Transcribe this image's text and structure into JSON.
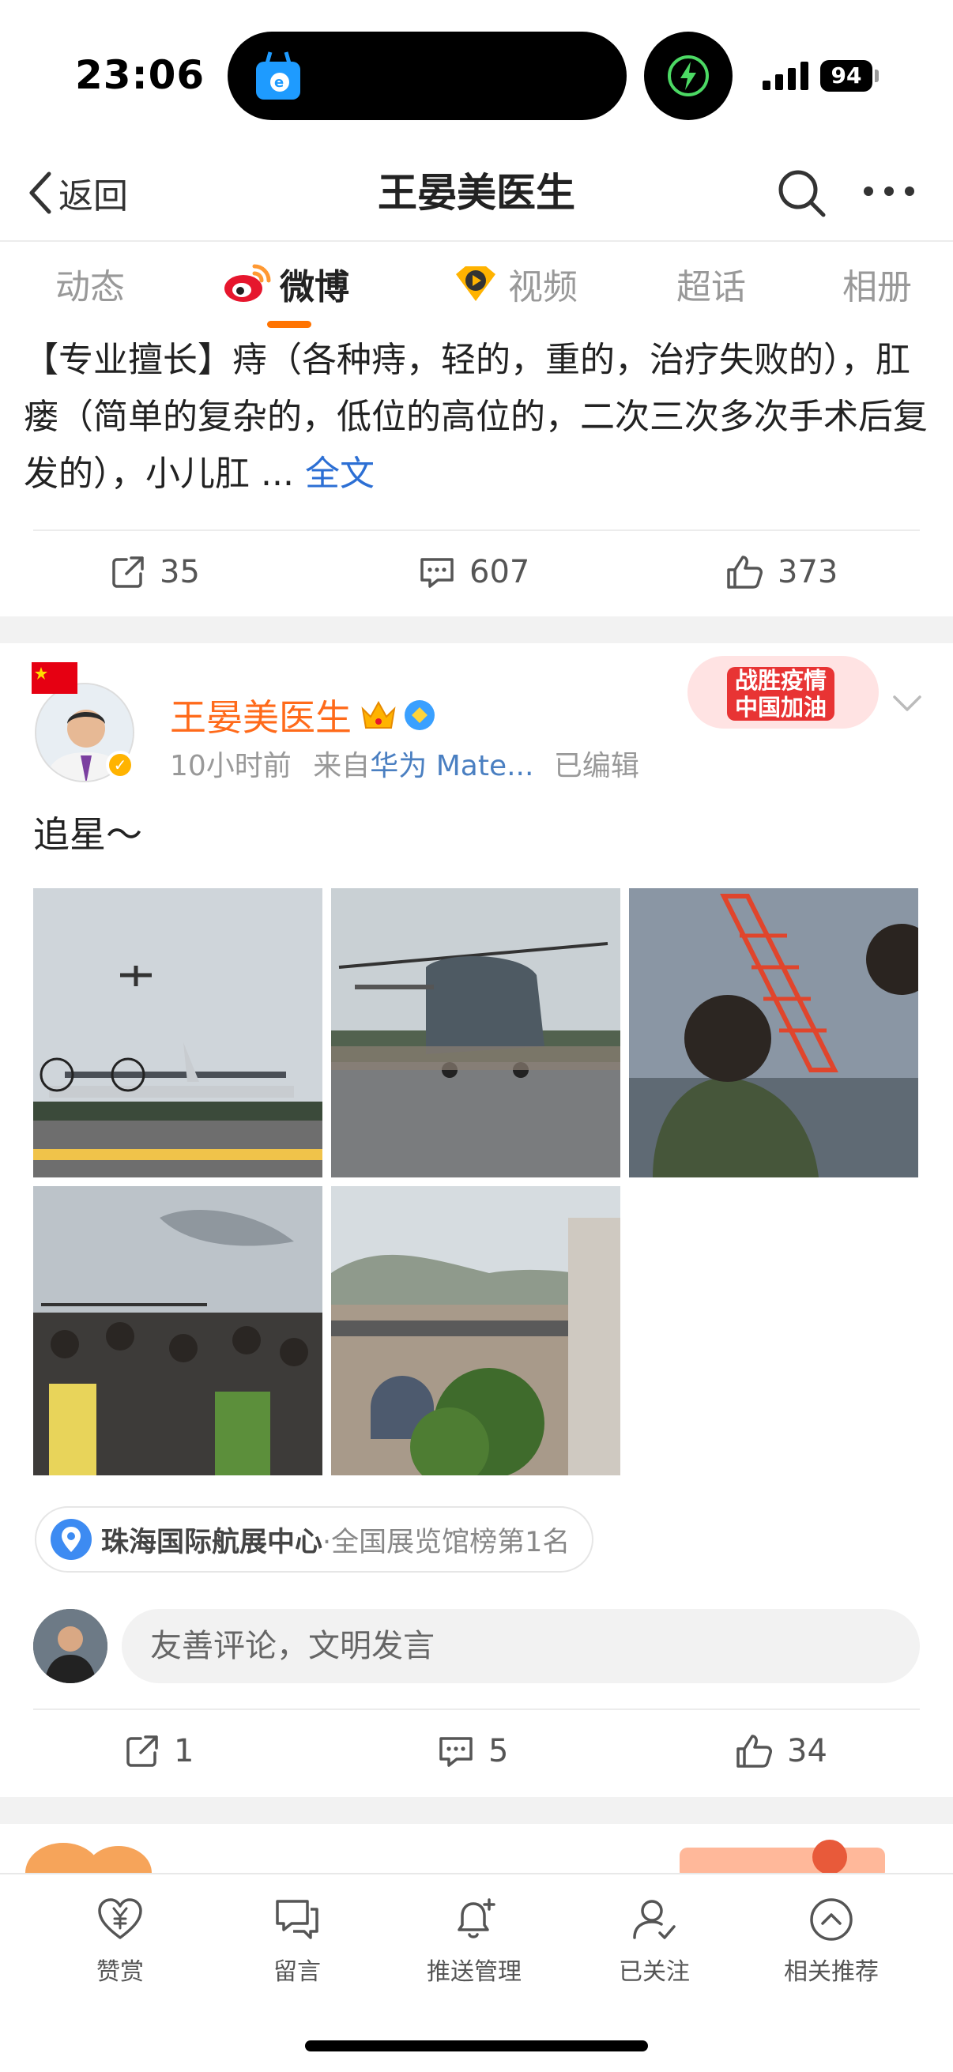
{
  "status_bar": {
    "time": "23:06",
    "battery": "94"
  },
  "nav": {
    "back_label": "返回",
    "title": "王晏美医生"
  },
  "tabs": [
    {
      "label": "动态"
    },
    {
      "label": "微博"
    },
    {
      "label": "视频"
    },
    {
      "label": "超话"
    },
    {
      "label": "相册"
    }
  ],
  "post1": {
    "text": "【专业擅长】痔（各种痔，轻的，重的，治疗失败的），肛瘘（简单的复杂的，低位的高位的，二次三次多次手术后复发的），小儿肛 ...",
    "full_link": "全文",
    "reposts": "35",
    "comments": "607",
    "likes": "373"
  },
  "post2": {
    "author": "王晏美医生",
    "time": "10小时前",
    "source_prefix": "来自",
    "source": "华为 Mate...",
    "edited": "已编辑",
    "campaign_line1": "战胜疫情",
    "campaign_line2": "中国加油",
    "text": "追星～",
    "location_name": "珠海国际航展中心",
    "location_rank": "·全国展览馆榜第1名",
    "comment_placeholder": "友善评论，文明发言",
    "reposts": "1",
    "comments": "5",
    "likes": "34"
  },
  "bottom_bar": [
    {
      "label": "赞赏",
      "icon": "yen-heart-icon"
    },
    {
      "label": "留言",
      "icon": "message-icon"
    },
    {
      "label": "推送管理",
      "icon": "bell-plus-icon"
    },
    {
      "label": "已关注",
      "icon": "user-check-icon"
    },
    {
      "label": "相关推荐",
      "icon": "chevron-up-circle-icon"
    }
  ],
  "colors": {
    "accent": "#ff7300",
    "author": "#ff6a1a",
    "link": "#2c6fd4"
  }
}
